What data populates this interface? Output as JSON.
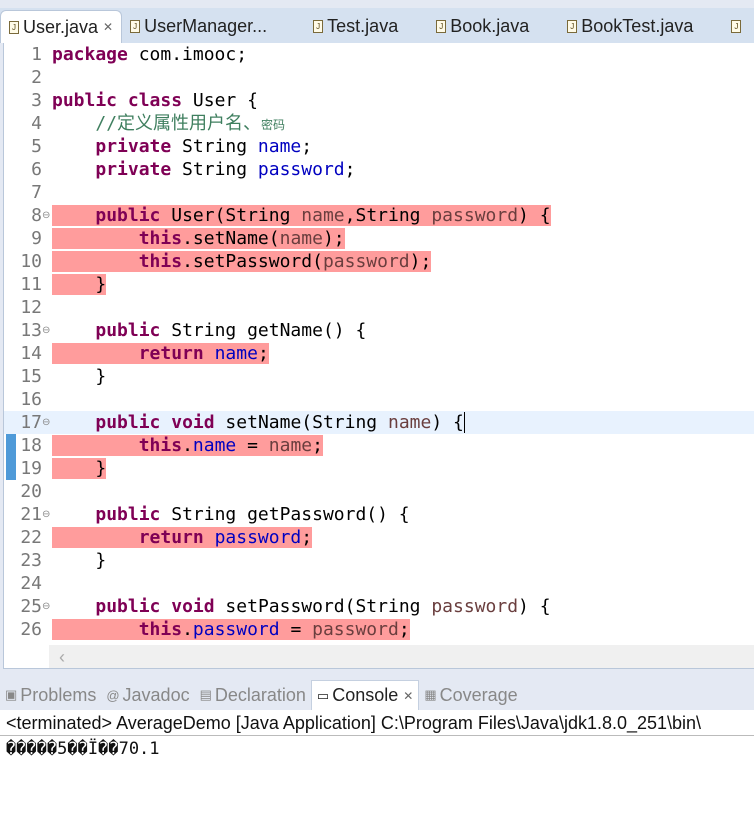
{
  "tabs": [
    {
      "label": "User.java",
      "active": true,
      "closable": true
    },
    {
      "label": "UserManager..."
    },
    {
      "label": "Test.java"
    },
    {
      "label": "Book.java"
    },
    {
      "label": "BookTest.java"
    },
    {
      "label": ""
    }
  ],
  "editor": {
    "current_line": 17,
    "highlight_color": "#ff9c9c",
    "folds": [
      8,
      13,
      17,
      21,
      25
    ],
    "lines": [
      {
        "n": "1",
        "t": [
          [
            "kw",
            "package"
          ],
          [
            "",
            " com.imooc;"
          ]
        ]
      },
      {
        "n": "2",
        "t": []
      },
      {
        "n": "3",
        "t": [
          [
            "kw",
            "public"
          ],
          [
            "",
            " "
          ],
          [
            "kw",
            "class"
          ],
          [
            "",
            " User {"
          ]
        ]
      },
      {
        "n": "4",
        "t": [
          [
            "",
            "    "
          ],
          [
            "cmt",
            "//定义属性用户名、"
          ],
          [
            "cmts",
            "密码"
          ]
        ]
      },
      {
        "n": "5",
        "t": [
          [
            "",
            "    "
          ],
          [
            "kw",
            "private"
          ],
          [
            "",
            " String "
          ],
          [
            "fld",
            "name"
          ],
          [
            "",
            ";"
          ]
        ]
      },
      {
        "n": "6",
        "t": [
          [
            "",
            "    "
          ],
          [
            "kw",
            "private"
          ],
          [
            "",
            " String "
          ],
          [
            "fld",
            "password"
          ],
          [
            "",
            ";"
          ]
        ]
      },
      {
        "n": "7",
        "t": []
      },
      {
        "n": "8",
        "cov": true,
        "t": [
          [
            "",
            "    "
          ],
          [
            "kw",
            "public"
          ],
          [
            "",
            " User(String "
          ],
          [
            "par",
            "name"
          ],
          [
            "",
            ",String "
          ],
          [
            "par",
            "password"
          ],
          [
            "",
            ") {"
          ]
        ]
      },
      {
        "n": "9",
        "cov": true,
        "t": [
          [
            "",
            "        "
          ],
          [
            "kw",
            "this"
          ],
          [
            "",
            ".setName("
          ],
          [
            "par",
            "name"
          ],
          [
            "",
            ");"
          ]
        ]
      },
      {
        "n": "10",
        "cov": true,
        "t": [
          [
            "",
            "        "
          ],
          [
            "kw",
            "this"
          ],
          [
            "",
            ".setPassword("
          ],
          [
            "par",
            "password"
          ],
          [
            "",
            ");"
          ]
        ]
      },
      {
        "n": "11",
        "cov": true,
        "t": [
          [
            "",
            "    }"
          ]
        ]
      },
      {
        "n": "12",
        "t": []
      },
      {
        "n": "13",
        "t": [
          [
            "",
            "    "
          ],
          [
            "kw",
            "public"
          ],
          [
            "",
            " String getName() {"
          ]
        ]
      },
      {
        "n": "14",
        "cov": true,
        "t": [
          [
            "",
            "        "
          ],
          [
            "kw",
            "return"
          ],
          [
            "",
            " "
          ],
          [
            "fld",
            "name"
          ],
          [
            "",
            ";"
          ]
        ]
      },
      {
        "n": "15",
        "t": [
          [
            "",
            "    }"
          ]
        ]
      },
      {
        "n": "16",
        "t": []
      },
      {
        "n": "17",
        "t": [
          [
            "",
            "    "
          ],
          [
            "kw",
            "public"
          ],
          [
            "",
            " "
          ],
          [
            "kw",
            "void"
          ],
          [
            "",
            " setName(String "
          ],
          [
            "par",
            "name"
          ],
          [
            "",
            ") {"
          ],
          [
            "caret",
            ""
          ]
        ]
      },
      {
        "n": "18",
        "cov": true,
        "t": [
          [
            "",
            "        "
          ],
          [
            "kw",
            "this"
          ],
          [
            "",
            "."
          ],
          [
            "fld",
            "name"
          ],
          [
            "",
            " = "
          ],
          [
            "par",
            "name"
          ],
          [
            "",
            ";"
          ]
        ]
      },
      {
        "n": "19",
        "cov": true,
        "t": [
          [
            "",
            "    }"
          ]
        ]
      },
      {
        "n": "20",
        "t": []
      },
      {
        "n": "21",
        "t": [
          [
            "",
            "    "
          ],
          [
            "kw",
            "public"
          ],
          [
            "",
            " String getPassword() {"
          ]
        ]
      },
      {
        "n": "22",
        "cov": true,
        "t": [
          [
            "",
            "        "
          ],
          [
            "kw",
            "return"
          ],
          [
            "",
            " "
          ],
          [
            "fld",
            "password"
          ],
          [
            "",
            ";"
          ]
        ]
      },
      {
        "n": "23",
        "t": [
          [
            "",
            "    }"
          ]
        ]
      },
      {
        "n": "24",
        "t": []
      },
      {
        "n": "25",
        "t": [
          [
            "",
            "    "
          ],
          [
            "kw",
            "public"
          ],
          [
            "",
            " "
          ],
          [
            "kw",
            "void"
          ],
          [
            "",
            " setPassword(String "
          ],
          [
            "par",
            "password"
          ],
          [
            "",
            ") {"
          ]
        ]
      },
      {
        "n": "26",
        "cov": true,
        "t": [
          [
            "",
            "        "
          ],
          [
            "kw",
            "this"
          ],
          [
            "",
            "."
          ],
          [
            "fld",
            "password"
          ],
          [
            "",
            " = "
          ],
          [
            "par",
            "password"
          ],
          [
            "",
            ";"
          ]
        ]
      }
    ],
    "scroll_left": "‹"
  },
  "panel": {
    "tabs": [
      {
        "label": "Problems",
        "icon": "problems-icon"
      },
      {
        "label": "Javadoc",
        "icon": "at-icon"
      },
      {
        "label": "Declaration",
        "icon": "declaration-icon"
      },
      {
        "label": "Console",
        "icon": "console-icon",
        "active": true
      },
      {
        "label": "Coverage",
        "icon": "coverage-icon"
      }
    ],
    "console_header": "<terminated> AverageDemo [Java Application] C:\\Program Files\\Java\\jdk1.8.0_251\\bin\\",
    "console_output": "�����5��Ï��70.1"
  }
}
